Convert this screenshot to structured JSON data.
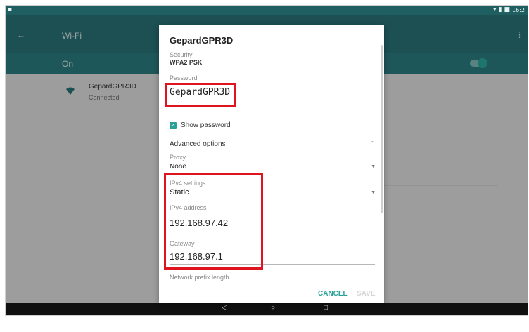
{
  "statusbar": {
    "time": "16:2"
  },
  "appbar": {
    "title": "Wi-Fi"
  },
  "wifi_bar": {
    "on_label": "On"
  },
  "network": {
    "name": "GepardGPR3D",
    "status": "Connected"
  },
  "dialog": {
    "title": "GepardGPR3D",
    "security_label": "Security",
    "security_value": "WPA2 PSK",
    "password_label": "Password",
    "password_value": "GepardGPR3D",
    "show_password_label": "Show password",
    "advanced_label": "Advanced options",
    "proxy_label": "Proxy",
    "proxy_value": "None",
    "ipv4_settings_label": "IPv4 settings",
    "ipv4_settings_value": "Static",
    "ipv4_address_label": "IPv4 address",
    "ipv4_address_value": "192.168.97.42",
    "gateway_label": "Gateway",
    "gateway_value": "192.168.97.1",
    "prefix_label": "Network prefix length",
    "cancel_label": "CANCEL",
    "save_label": "SAVE"
  },
  "colors": {
    "accent": "#2aa198",
    "highlight": "#e0141e",
    "appbar": "#2b7b80"
  }
}
